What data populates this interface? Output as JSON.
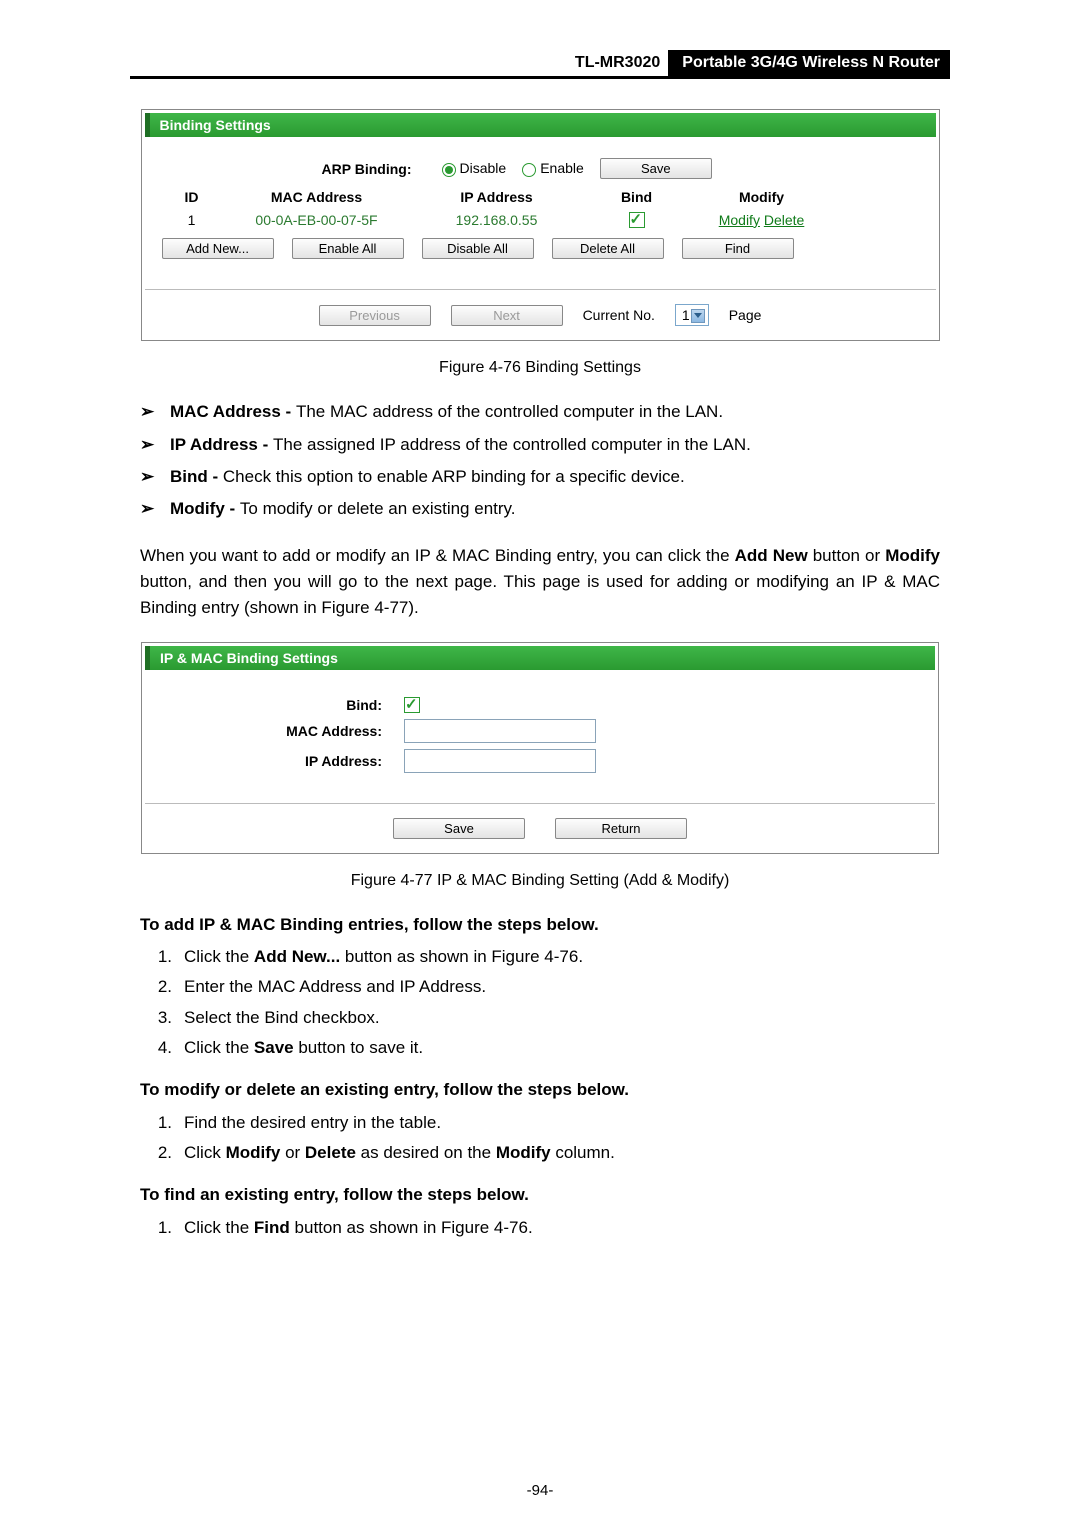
{
  "header": {
    "model": "TL-MR3020",
    "product": "Portable 3G/4G Wireless N Router"
  },
  "fig1": {
    "panel_title": "Binding Settings",
    "arp_label": "ARP Binding:",
    "radio_disable": "Disable",
    "radio_enable": "Enable",
    "save_btn": "Save",
    "cols": {
      "id": "ID",
      "mac": "MAC Address",
      "ip": "IP Address",
      "bind": "Bind",
      "modify": "Modify"
    },
    "row1": {
      "id": "1",
      "mac": "00-0A-EB-00-07-5F",
      "ip": "192.168.0.55",
      "modify": "Modify",
      "delete": "Delete"
    },
    "btns": {
      "add": "Add New...",
      "enable": "Enable All",
      "disable": "Disable All",
      "delete": "Delete All",
      "find": "Find"
    },
    "pager": {
      "prev": "Previous",
      "next": "Next",
      "curno_lbl": "Current No.",
      "curno_val": "1",
      "page_lbl": "Page"
    }
  },
  "caption1": "Figure 4-76 Binding Settings",
  "bullets": [
    {
      "b": "MAC Address - ",
      "t": "The MAC address of the controlled computer in the LAN."
    },
    {
      "b": "IP Address - ",
      "t": "The assigned IP address of the controlled computer in the LAN."
    },
    {
      "b": "Bind - ",
      "t": "Check this option to enable ARP binding for a specific device."
    },
    {
      "b": "Modify - ",
      "t": "To modify or delete an existing entry."
    }
  ],
  "para1": {
    "p1": "When you want to add or modify an IP & MAC Binding entry, you can click the ",
    "p2": "Add New",
    "p3": " button or ",
    "p4": "Modify",
    "p5": " button, and then you will go to the next page. This page is used for adding or modifying an IP & MAC Binding entry (shown in Figure 4-77)."
  },
  "fig2": {
    "panel_title": "IP & MAC Binding Settings",
    "bind_lbl": "Bind:",
    "mac_lbl": "MAC Address:",
    "ip_lbl": "IP Address:",
    "save": "Save",
    "return": "Return"
  },
  "caption2": "Figure 4-77    IP & MAC Binding Setting (Add & Modify)",
  "h_add": "To add IP & MAC Binding entries, follow the steps below.",
  "steps_add": [
    {
      "n": "1.",
      "pre": "Click the ",
      "b": "Add New...",
      "post": " button as shown in Figure 4-76."
    },
    {
      "n": "2.",
      "pre": "Enter the MAC Address and IP Address.",
      "b": "",
      "post": ""
    },
    {
      "n": "3.",
      "pre": "Select the Bind checkbox.",
      "b": "",
      "post": ""
    },
    {
      "n": "4.",
      "pre": "Click the ",
      "b": "Save",
      "post": " button to save it."
    }
  ],
  "h_mod": "To modify or delete an existing entry, follow the steps below.",
  "steps_mod": [
    {
      "n": "1.",
      "pre": "Find the desired entry in the table.",
      "b": "",
      "post": ""
    },
    {
      "n": "2.",
      "pre": "Click ",
      "b": "Modify",
      "mid": " or ",
      "b2": "Delete",
      "post2": " as desired on the ",
      "b3": "Modify",
      "post3": " column."
    }
  ],
  "h_find": "To find an existing entry, follow the steps below.",
  "steps_find": [
    {
      "n": "1.",
      "pre": "Click the ",
      "b": "Find",
      "post": " button as shown in Figure 4-76."
    }
  ],
  "page_number": "-94-"
}
